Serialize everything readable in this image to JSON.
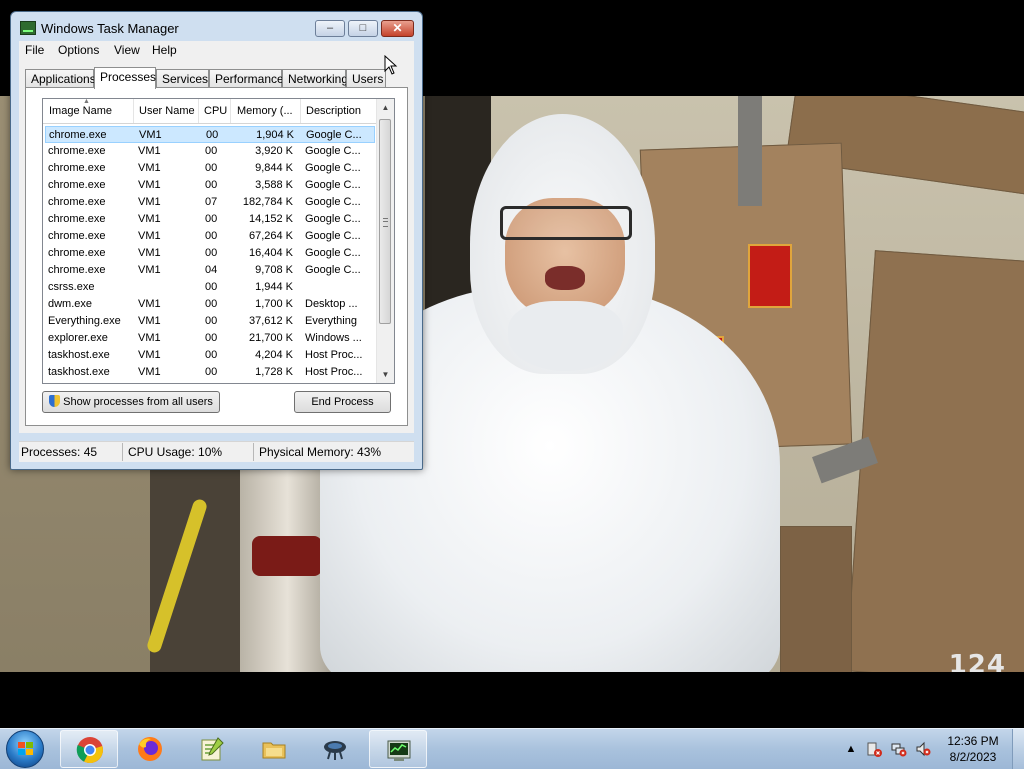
{
  "window": {
    "title": "Windows Task Manager",
    "controls": {
      "minimize": "–",
      "maximize": "□",
      "close": "✕"
    }
  },
  "menu": [
    "File",
    "Options",
    "View",
    "Help"
  ],
  "tabs": [
    "Applications",
    "Processes",
    "Services",
    "Performance",
    "Networking",
    "Users"
  ],
  "active_tab": "Processes",
  "columns": [
    "Image Name",
    "User Name",
    "CPU",
    "Memory (...",
    "Description"
  ],
  "processes": [
    {
      "name": "chrome.exe",
      "user": "VM1",
      "cpu": "00",
      "memory": "1,904 K",
      "description": "Google C...",
      "selected": true
    },
    {
      "name": "chrome.exe",
      "user": "VM1",
      "cpu": "00",
      "memory": "3,920 K",
      "description": "Google C..."
    },
    {
      "name": "chrome.exe",
      "user": "VM1",
      "cpu": "00",
      "memory": "9,844 K",
      "description": "Google C..."
    },
    {
      "name": "chrome.exe",
      "user": "VM1",
      "cpu": "00",
      "memory": "3,588 K",
      "description": "Google C..."
    },
    {
      "name": "chrome.exe",
      "user": "VM1",
      "cpu": "07",
      "memory": "182,784 K",
      "description": "Google C..."
    },
    {
      "name": "chrome.exe",
      "user": "VM1",
      "cpu": "00",
      "memory": "14,152 K",
      "description": "Google C..."
    },
    {
      "name": "chrome.exe",
      "user": "VM1",
      "cpu": "00",
      "memory": "67,264 K",
      "description": "Google C..."
    },
    {
      "name": "chrome.exe",
      "user": "VM1",
      "cpu": "00",
      "memory": "16,404 K",
      "description": "Google C..."
    },
    {
      "name": "chrome.exe",
      "user": "VM1",
      "cpu": "04",
      "memory": "9,708 K",
      "description": "Google C..."
    },
    {
      "name": "csrss.exe",
      "user": "",
      "cpu": "00",
      "memory": "1,944 K",
      "description": ""
    },
    {
      "name": "dwm.exe",
      "user": "VM1",
      "cpu": "00",
      "memory": "1,700 K",
      "description": "Desktop ..."
    },
    {
      "name": "Everything.exe",
      "user": "VM1",
      "cpu": "00",
      "memory": "37,612 K",
      "description": "Everything"
    },
    {
      "name": "explorer.exe",
      "user": "VM1",
      "cpu": "00",
      "memory": "21,700 K",
      "description": "Windows ..."
    },
    {
      "name": "taskhost.exe",
      "user": "VM1",
      "cpu": "00",
      "memory": "4,204 K",
      "description": "Host Proc..."
    },
    {
      "name": "taskhost.exe",
      "user": "VM1",
      "cpu": "00",
      "memory": "1,728 K",
      "description": "Host Proc..."
    }
  ],
  "buttons": {
    "show_all": "Show processes from all users",
    "end_process": "End Process"
  },
  "status": {
    "processes": "Processes: 45",
    "cpu": "CPU Usage: 10%",
    "memory": "Physical Memory: 43%"
  },
  "taskbar": {
    "apps": [
      {
        "name": "chrome-icon",
        "active": true
      },
      {
        "name": "firefox-icon"
      },
      {
        "name": "notepad-plus-plus-icon"
      },
      {
        "name": "file-explorer-icon"
      },
      {
        "name": "network-share-icon"
      },
      {
        "name": "task-manager-icon",
        "running": true
      }
    ],
    "clock_time": "12:36 PM",
    "clock_date": "8/2/2023"
  },
  "video": {
    "watermark": "124"
  },
  "colors": {
    "taskbar": "#a9c2dd",
    "window_frame": "#cfdff0",
    "selection": "#cce8ff"
  }
}
